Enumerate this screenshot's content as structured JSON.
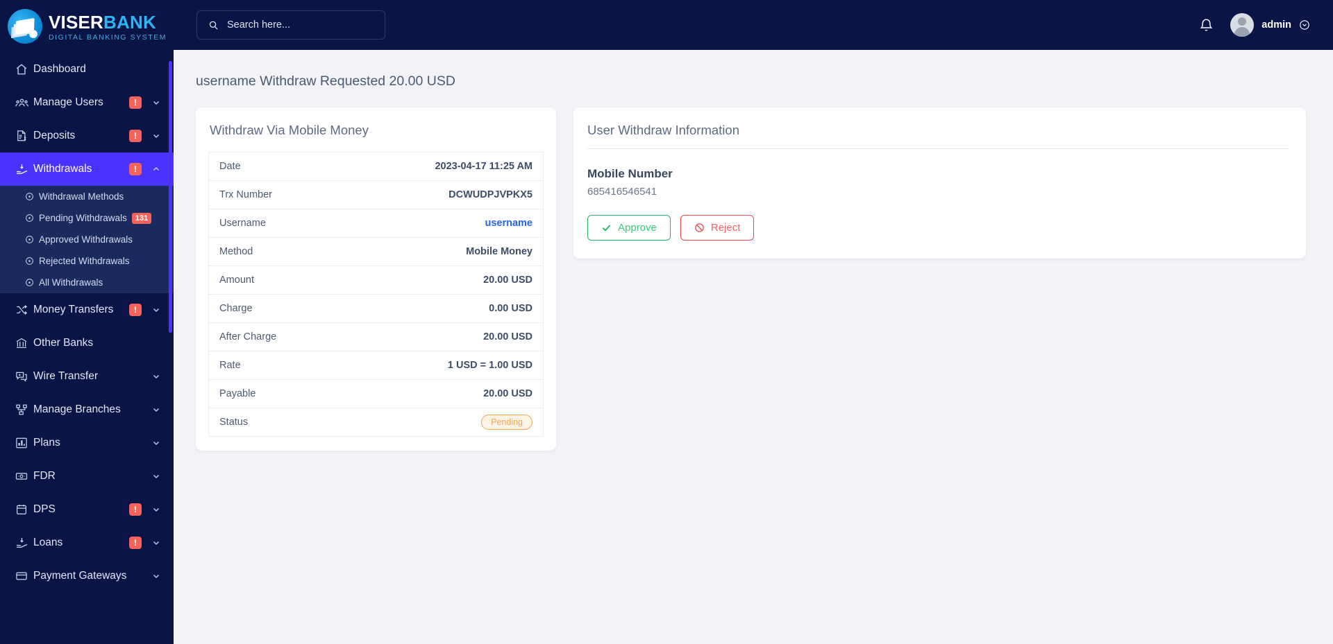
{
  "brand": {
    "name_white": "VISER",
    "name_blue": "BANK",
    "tagline": "DIGITAL BANKING SYSTEM",
    "logo_icon": "bank-notes-logo"
  },
  "topbar": {
    "search_placeholder": "Search here...",
    "search_value": "",
    "search_icon": "search-icon",
    "bell_icon": "notification-bell-icon",
    "username": "admin",
    "caret_icon": "chevron-down-circle-icon",
    "avatar_icon": "user-avatar"
  },
  "sidebar": {
    "items": [
      {
        "label": "Dashboard",
        "icon": "home-icon",
        "alert": false,
        "chevron": false,
        "active": false
      },
      {
        "label": "Manage Users",
        "icon": "users-icon",
        "alert": true,
        "chevron": "down",
        "active": false
      },
      {
        "label": "Deposits",
        "icon": "invoice-dollar-icon",
        "alert": true,
        "chevron": "down",
        "active": false
      },
      {
        "label": "Withdrawals",
        "icon": "withdraw-hand-icon",
        "alert": true,
        "chevron": "up",
        "active": true
      },
      {
        "label": "Money Transfers",
        "icon": "shuffle-icon",
        "alert": true,
        "chevron": "down",
        "active": false
      },
      {
        "label": "Other Banks",
        "icon": "bank-icon",
        "alert": false,
        "chevron": false,
        "active": false
      },
      {
        "label": "Wire Transfer",
        "icon": "money-chat-icon",
        "alert": false,
        "chevron": "down",
        "active": false
      },
      {
        "label": "Manage Branches",
        "icon": "branches-icon",
        "alert": false,
        "chevron": "down",
        "active": false
      },
      {
        "label": "Plans",
        "icon": "bar-chart-icon",
        "alert": false,
        "chevron": "down",
        "active": false
      },
      {
        "label": "FDR",
        "icon": "banknote-icon",
        "alert": false,
        "chevron": "down",
        "active": false
      },
      {
        "label": "DPS",
        "icon": "calendar-box-icon",
        "alert": true,
        "chevron": "down",
        "active": false
      },
      {
        "label": "Loans",
        "icon": "withdraw-hand-icon",
        "alert": true,
        "chevron": "down",
        "active": false
      },
      {
        "label": "Payment Gateways",
        "icon": "credit-card-icon",
        "alert": false,
        "chevron": "down",
        "active": false
      }
    ],
    "alert_badge_text": "!",
    "submenu": [
      {
        "label": "Withdrawal Methods",
        "icon": "circle-dot-icon",
        "count": ""
      },
      {
        "label": "Pending Withdrawals",
        "icon": "circle-dot-icon",
        "count": "131"
      },
      {
        "label": "Approved Withdrawals",
        "icon": "circle-dot-icon",
        "count": ""
      },
      {
        "label": "Rejected Withdrawals",
        "icon": "circle-dot-icon",
        "count": ""
      },
      {
        "label": "All Withdrawals",
        "icon": "circle-dot-icon",
        "count": ""
      }
    ]
  },
  "page": {
    "title": "username Withdraw Requested 20.00 USD"
  },
  "withdraw_card": {
    "title": "Withdraw Via Mobile Money",
    "rows": [
      {
        "key": "Date",
        "value": "2023-04-17 11:25 AM",
        "kind": "text"
      },
      {
        "key": "Trx Number",
        "value": "DCWUDPJVPKX5",
        "kind": "text"
      },
      {
        "key": "Username",
        "value": "username",
        "kind": "link"
      },
      {
        "key": "Method",
        "value": "Mobile Money",
        "kind": "text"
      },
      {
        "key": "Amount",
        "value": "20.00 USD",
        "kind": "text"
      },
      {
        "key": "Charge",
        "value": "0.00 USD",
        "kind": "text"
      },
      {
        "key": "After Charge",
        "value": "20.00 USD",
        "kind": "text"
      },
      {
        "key": "Rate",
        "value": "1 USD = 1.00 USD",
        "kind": "text"
      },
      {
        "key": "Payable",
        "value": "20.00 USD",
        "kind": "text"
      },
      {
        "key": "Status",
        "value": "Pending",
        "kind": "badge"
      }
    ]
  },
  "user_info_card": {
    "title": "User Withdraw Information",
    "field_label": "Mobile Number",
    "field_value": "685416546541",
    "approve_label": "Approve",
    "approve_icon": "check-icon",
    "reject_label": "Reject",
    "reject_icon": "ban-icon"
  },
  "colors": {
    "sidebar_bg": "#0b1446",
    "sidebar_submenu_bg": "#1b2a5e",
    "accent_active": "#4a33ff",
    "alert_red": "#f4645b",
    "link_blue": "#2563f0",
    "pending_orange": "#f0a44c",
    "approve_green": "#27b264",
    "reject_red": "#e8454b",
    "page_bg": "#f2f2f7"
  }
}
